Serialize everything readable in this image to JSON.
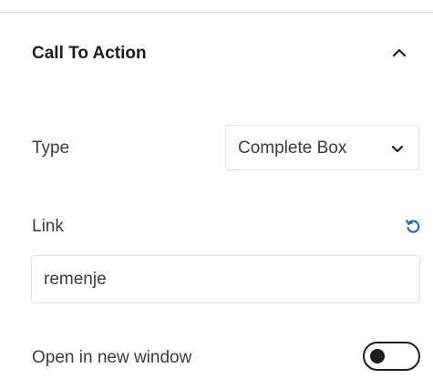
{
  "panel": {
    "title": "Call To Action",
    "expanded": true,
    "collapse_icon": "chevron-up-icon"
  },
  "type_field": {
    "label": "Type",
    "selected": "Complete Box",
    "dropdown_icon": "chevron-down-icon"
  },
  "link_field": {
    "label": "Link",
    "value": "remenje",
    "reset_icon": "reset-icon",
    "reset_color": "#2271b1"
  },
  "new_window": {
    "label": "Open in new window",
    "enabled": false
  }
}
